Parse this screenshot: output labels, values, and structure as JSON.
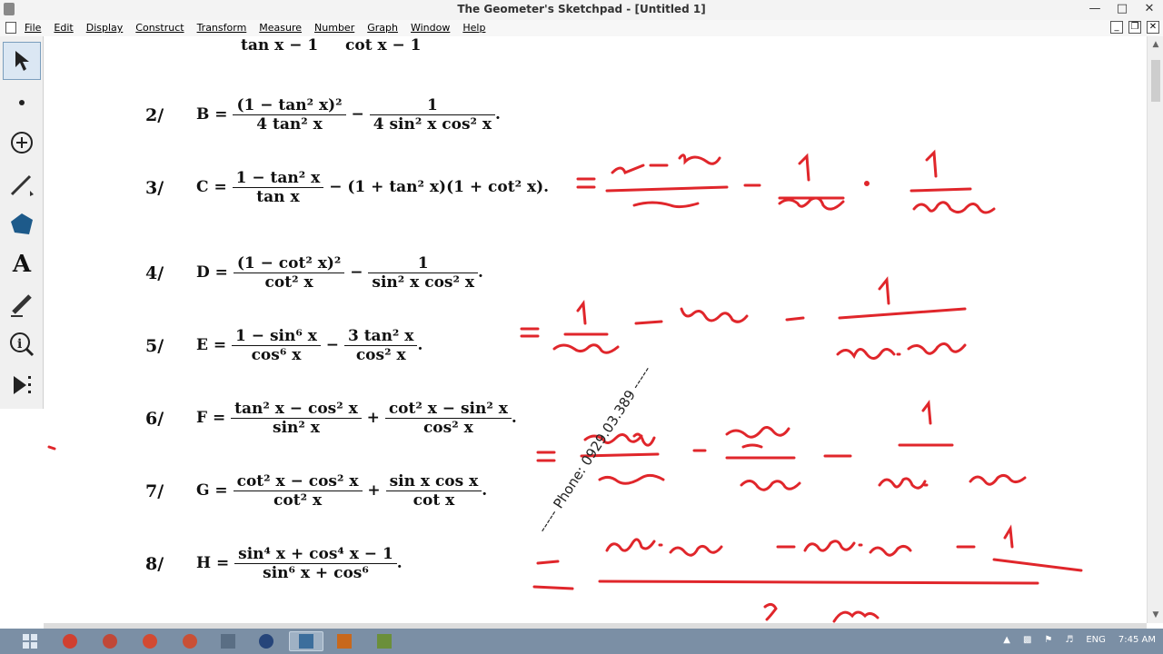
{
  "window": {
    "title": "The Geometer's Sketchpad - [Untitled 1]"
  },
  "menu": {
    "items": [
      "File",
      "Edit",
      "Display",
      "Construct",
      "Transform",
      "Measure",
      "Number",
      "Graph",
      "Window",
      "Help"
    ]
  },
  "toolbox": {
    "tools": [
      "select-arrow",
      "point",
      "compass",
      "straightedge",
      "polygon",
      "text",
      "marker",
      "information",
      "custom-tool"
    ]
  },
  "content": {
    "top_partial": {
      "left": "tan x − 1",
      "right": "cot x − 1"
    },
    "problems": [
      {
        "num": "2/",
        "label": "B =",
        "expr_a_num": "(1 − tan² x)²",
        "expr_a_den": "4 tan² x",
        "op": "−",
        "expr_b_num": "1",
        "expr_b_den": "4 sin² x cos² x",
        "tail": "."
      },
      {
        "num": "3/",
        "label": "C =",
        "expr_a_num": "1 − tan² x",
        "expr_a_den": "tan x",
        "op": "−",
        "expr_rest": "(1 + tan² x)(1 + cot² x)."
      },
      {
        "num": "4/",
        "label": "D =",
        "expr_a_num": "(1 − cot² x)²",
        "expr_a_den": "cot² x",
        "op": "−",
        "expr_b_num": "1",
        "expr_b_den": "sin² x cos² x",
        "tail": "."
      },
      {
        "num": "5/",
        "label": "E =",
        "expr_a_num": "1 − sin⁶ x",
        "expr_a_den": "cos⁶ x",
        "op": "−",
        "expr_b_num": "3 tan² x",
        "expr_b_den": "cos² x",
        "tail": "."
      },
      {
        "num": "6/",
        "label": "F =",
        "expr_a_num": "tan² x − cos² x",
        "expr_a_den": "sin² x",
        "op": "+",
        "expr_b_num": "cot² x − sin² x",
        "expr_b_den": "cos² x",
        "tail": "."
      },
      {
        "num": "7/",
        "label": "G =",
        "expr_a_num": "cot² x − cos² x",
        "expr_a_den": "cot² x",
        "op": "+",
        "expr_b_num": "sin x cos x",
        "expr_b_den": "cot x",
        "tail": "."
      },
      {
        "num": "8/",
        "label": "H =",
        "expr_a_num": "sin⁴ x + cos⁴ x − 1",
        "expr_a_den": "sin⁶ x + cos⁶",
        "tail": "."
      }
    ],
    "watermark": "----- Phone: 0929.03.389 -----"
  },
  "taskbar": {
    "tray": {
      "lang": "ENG",
      "time": "7:45 AM"
    }
  },
  "colors": {
    "ink": "#e0262b",
    "taskbar": "#7b8fa5"
  }
}
